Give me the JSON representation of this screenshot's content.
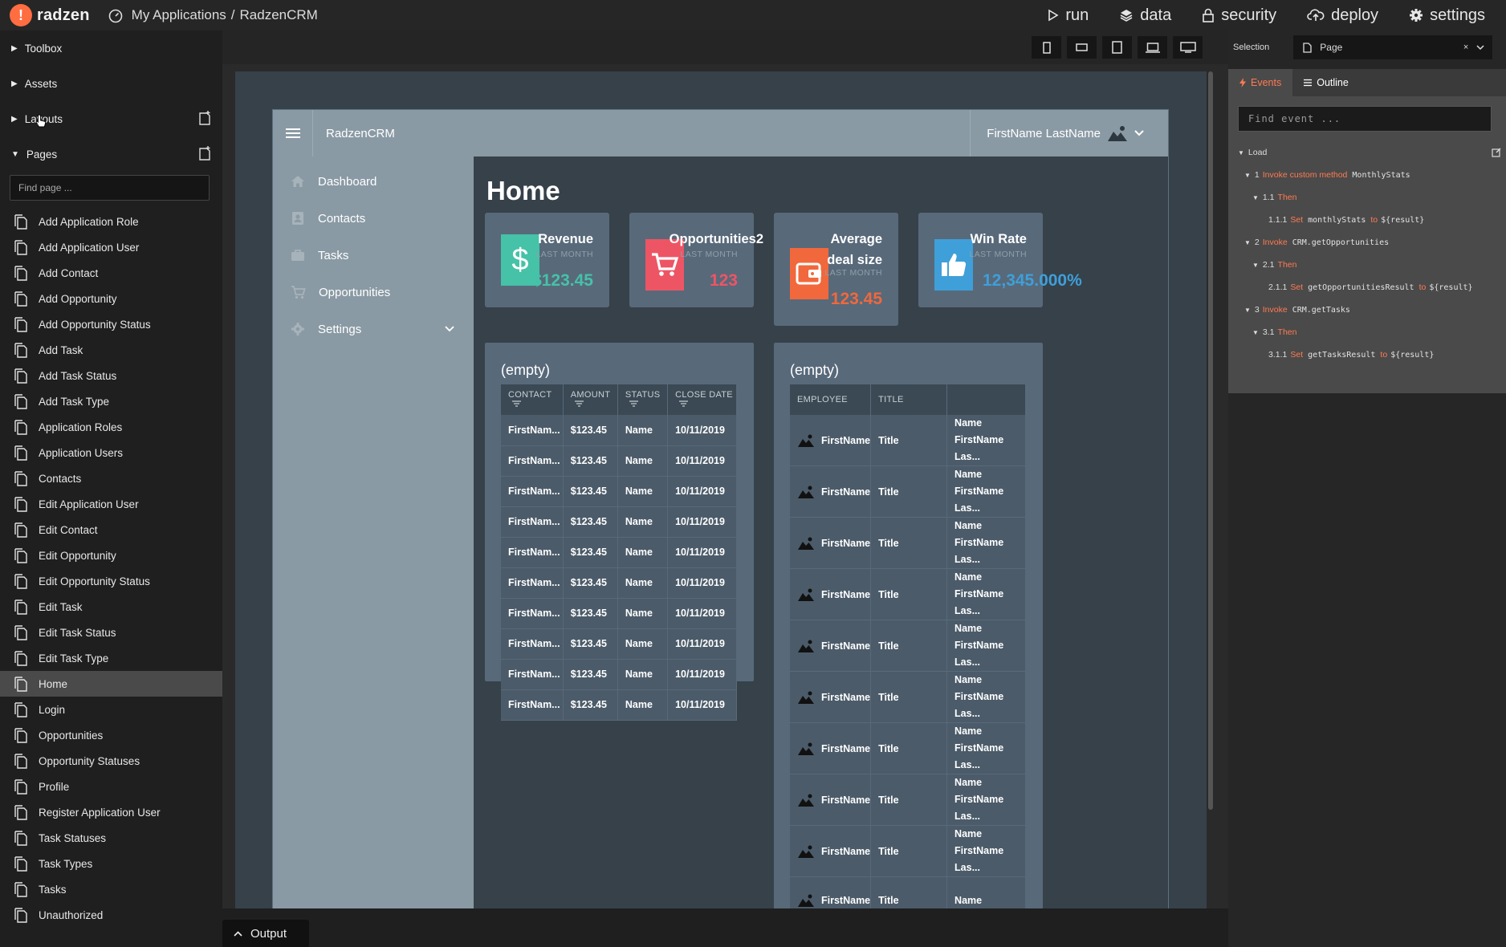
{
  "topbar": {
    "logo_mark": "!",
    "logo_text": "radzen",
    "breadcrumb": [
      "My Applications",
      "RadzenCRM"
    ],
    "breadcrumb_sep": "/",
    "nav": [
      {
        "label": "run",
        "icon": "play-icon"
      },
      {
        "label": "data",
        "icon": "layers-icon"
      },
      {
        "label": "security",
        "icon": "lock-icon"
      },
      {
        "label": "deploy",
        "icon": "cloud-upload-icon"
      },
      {
        "label": "settings",
        "icon": "gear-icon"
      }
    ]
  },
  "left_panel": {
    "sections": {
      "toolbox": "Toolbox",
      "assets": "Assets",
      "layouts": "Layouts",
      "pages": "Pages"
    },
    "find_page_placeholder": "Find page ...",
    "pages": [
      "Add Application Role",
      "Add Application User",
      "Add Contact",
      "Add Opportunity",
      "Add Opportunity Status",
      "Add Task",
      "Add Task Status",
      "Add Task Type",
      "Application Roles",
      "Application Users",
      "Contacts",
      "Edit Application User",
      "Edit Contact",
      "Edit Opportunity",
      "Edit Opportunity Status",
      "Edit Task",
      "Edit Task Status",
      "Edit Task Type",
      "Home",
      "Login",
      "Opportunities",
      "Opportunity Statuses",
      "Profile",
      "Register Application User",
      "Task Statuses",
      "Task Types",
      "Tasks",
      "Unauthorized"
    ],
    "active_page": "Home"
  },
  "device_toolbar": [
    "phone-portrait-icon",
    "phone-landscape-icon",
    "tablet-portrait-icon",
    "laptop-icon",
    "desktop-icon"
  ],
  "app": {
    "title": "RadzenCRM",
    "user": "FirstName LastName",
    "nav": [
      {
        "label": "Dashboard",
        "icon": "home-icon"
      },
      {
        "label": "Contacts",
        "icon": "contacts-icon"
      },
      {
        "label": "Tasks",
        "icon": "briefcase-icon"
      },
      {
        "label": "Opportunities",
        "icon": "cart-icon"
      },
      {
        "label": "Settings",
        "icon": "gear-icon"
      }
    ],
    "page_title": "Home",
    "cards": [
      {
        "title": "Revenue",
        "subtitle": "LAST MONTH",
        "value": "$123.45",
        "color": "#45c2a8",
        "icon": "dollar-icon"
      },
      {
        "title": "Opportunities2",
        "subtitle": "LAST MONTH",
        "value": "123",
        "color": "#ed5565",
        "icon": "cart-icon"
      },
      {
        "title": "Average deal size",
        "title_lines": [
          "Average",
          "deal size"
        ],
        "subtitle": "LAST MONTH",
        "value": "123.45",
        "color": "#f1683c",
        "icon": "wallet-icon"
      },
      {
        "title": "Win Rate",
        "subtitle": "LAST MONTH",
        "value": "12,345.000%",
        "color": "#3f9fd9",
        "icon": "thumbs-up-icon"
      }
    ],
    "panel1": {
      "title": "(empty)",
      "columns": [
        "CONTACT",
        "AMOUNT",
        "STATUS",
        "CLOSE DATE"
      ],
      "rows": [
        [
          "FirstNam...",
          "$123.45",
          "Name",
          "10/11/2019"
        ],
        [
          "FirstNam...",
          "$123.45",
          "Name",
          "10/11/2019"
        ],
        [
          "FirstNam...",
          "$123.45",
          "Name",
          "10/11/2019"
        ],
        [
          "FirstNam...",
          "$123.45",
          "Name",
          "10/11/2019"
        ],
        [
          "FirstNam...",
          "$123.45",
          "Name",
          "10/11/2019"
        ],
        [
          "FirstNam...",
          "$123.45",
          "Name",
          "10/11/2019"
        ],
        [
          "FirstNam...",
          "$123.45",
          "Name",
          "10/11/2019"
        ],
        [
          "FirstNam...",
          "$123.45",
          "Name",
          "10/11/2019"
        ],
        [
          "FirstNam...",
          "$123.45",
          "Name",
          "10/11/2019"
        ],
        [
          "FirstNam...",
          "$123.45",
          "Name",
          "10/11/2019"
        ]
      ]
    },
    "panel2": {
      "title": "(empty)",
      "columns": [
        "EMPLOYEE",
        "TITLE",
        ""
      ],
      "rows": [
        {
          "employee": "FirstName",
          "title": "Title",
          "name": "Name",
          "full": "FirstName Las..."
        },
        {
          "employee": "FirstName",
          "title": "Title",
          "name": "Name",
          "full": "FirstName Las..."
        },
        {
          "employee": "FirstName",
          "title": "Title",
          "name": "Name",
          "full": "FirstName Las..."
        },
        {
          "employee": "FirstName",
          "title": "Title",
          "name": "Name",
          "full": "FirstName Las..."
        },
        {
          "employee": "FirstName",
          "title": "Title",
          "name": "Name",
          "full": "FirstName Las..."
        },
        {
          "employee": "FirstName",
          "title": "Title",
          "name": "Name",
          "full": "FirstName Las..."
        },
        {
          "employee": "FirstName",
          "title": "Title",
          "name": "Name",
          "full": "FirstName Las..."
        },
        {
          "employee": "FirstName",
          "title": "Title",
          "name": "Name",
          "full": "FirstName Las..."
        },
        {
          "employee": "FirstName",
          "title": "Title",
          "name": "Name",
          "full": "FirstName Las..."
        },
        {
          "employee": "FirstName",
          "title": "Title",
          "name": "Name",
          "full": ""
        }
      ]
    }
  },
  "right_panel": {
    "selection_label": "Selection",
    "selection_value": "Page",
    "clear": "×",
    "tabs": [
      "Events",
      "Outline"
    ],
    "find_event_placeholder": "Find event ...",
    "event_group": "Load",
    "tree": [
      {
        "num": "1",
        "action": "Invoke custom method",
        "target": "MonthlyStats",
        "indent": 0
      },
      {
        "num": "1.1",
        "action": "Then",
        "target": "",
        "indent": 1
      },
      {
        "num": "1.1.1",
        "action": "Set",
        "target": "monthlyStats",
        "to": "to",
        "value": "${result}",
        "indent": 2
      },
      {
        "num": "2",
        "action": "Invoke",
        "target": "CRM.getOpportunities",
        "indent": 0
      },
      {
        "num": "2.1",
        "action": "Then",
        "target": "",
        "indent": 1
      },
      {
        "num": "2.1.1",
        "action": "Set",
        "target": "getOpportunitiesResult",
        "to": "to",
        "value": "${result}",
        "indent": 2
      },
      {
        "num": "3",
        "action": "Invoke",
        "target": "CRM.getTasks",
        "indent": 0
      },
      {
        "num": "3.1",
        "action": "Then",
        "target": "",
        "indent": 1
      },
      {
        "num": "3.1.1",
        "action": "Set",
        "target": "getTasksResult",
        "to": "to",
        "value": "${result}",
        "indent": 2
      }
    ]
  },
  "output_label": "Output"
}
